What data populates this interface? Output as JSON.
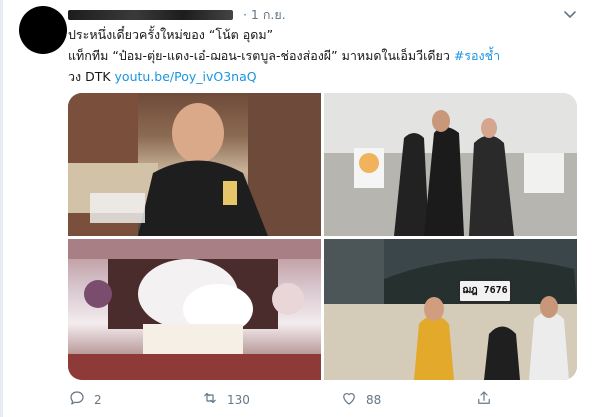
{
  "tweet": {
    "time": "· 1 ก.ย.",
    "text_line1": "ประหนึ่งเดี๋ยวครั้งใหม่ของ “โน้ต อุดม”",
    "text_line2_plain": "แท็กทีม “ป๋อม-ตุ่ย-แดง-เอ๋-ฌอน-เรตบูล-ช่องส่องผี” มาหมดในเอ็มวีเดียว ",
    "hashtag": "#รองช้ำ",
    "text_line3_plain": "วง DTK ",
    "link": "youtu.be/Poy_ivO3naQ"
  },
  "media": {
    "license_plate": "ฌฎ 7676"
  },
  "actions": {
    "reply_count": "2",
    "retweet_count": "130",
    "like_count": "88"
  },
  "colors": {
    "link": "#1b95e0",
    "secondary_text": "#657786"
  }
}
